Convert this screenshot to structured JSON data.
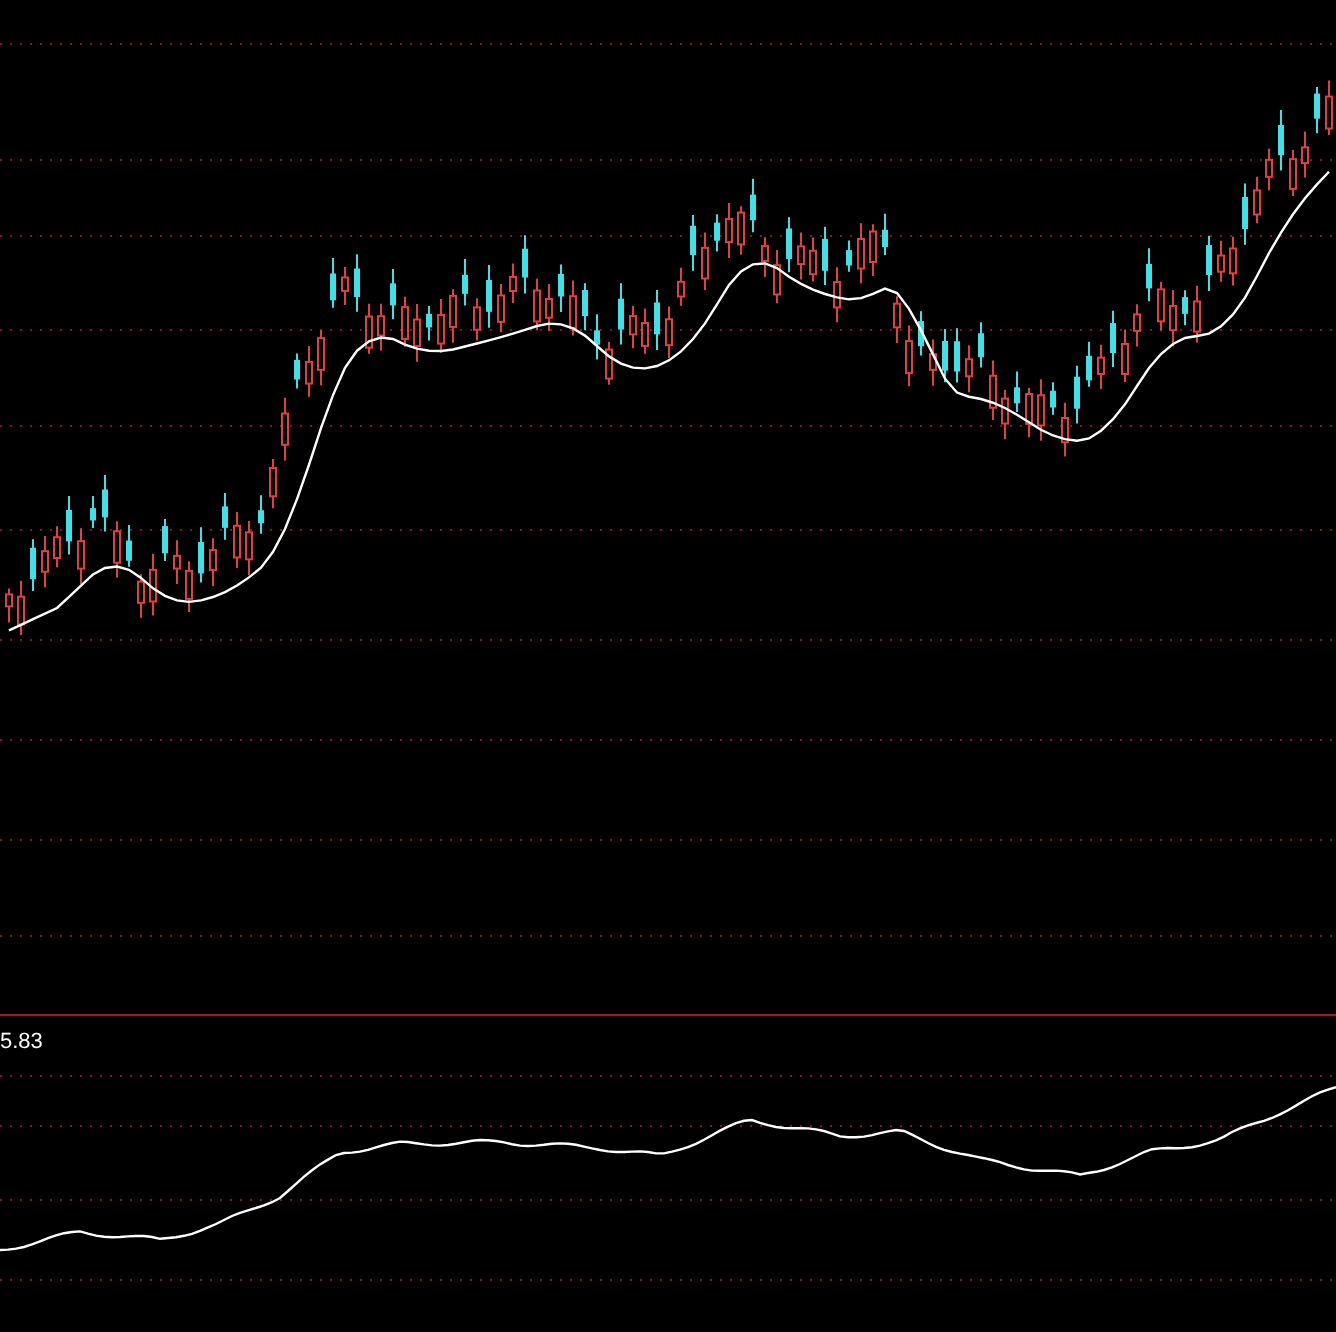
{
  "indicator_panel": {
    "value_label": "5.83"
  }
}
